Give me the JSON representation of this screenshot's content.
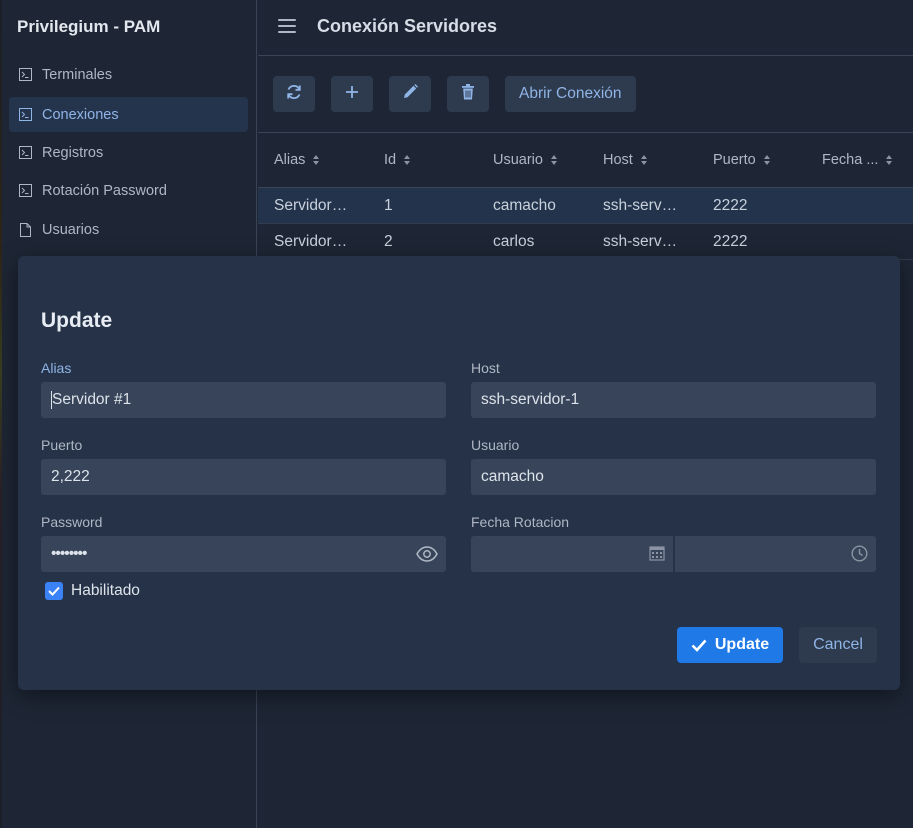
{
  "app": {
    "brand": "Privilegium - PAM"
  },
  "sidebar": {
    "items": [
      {
        "label": "Terminales",
        "icon": "terminal-icon"
      },
      {
        "label": "Conexiones",
        "icon": "terminal-icon",
        "active": true
      },
      {
        "label": "Registros",
        "icon": "terminal-icon"
      },
      {
        "label": "Rotación Password",
        "icon": "terminal-icon"
      },
      {
        "label": "Usuarios",
        "icon": "file-icon"
      }
    ]
  },
  "header": {
    "title": "Conexión Servidores"
  },
  "toolbar": {
    "refresh_icon": "refresh-icon",
    "add_icon": "plus-icon",
    "edit_icon": "pencil-icon",
    "delete_icon": "trash-icon",
    "open_label": "Abrir Conexión"
  },
  "table": {
    "columns": [
      "Alias",
      "Id",
      "Usuario",
      "Host",
      "Puerto",
      "Fecha ..."
    ],
    "rows": [
      [
        "Servidor…",
        "1",
        "camacho",
        "ssh-serv…",
        "2222",
        ""
      ],
      [
        "Servidor…",
        "2",
        "carlos",
        "ssh-serv…",
        "2222",
        ""
      ]
    ]
  },
  "dialog": {
    "title": "Update",
    "alias_label": "Alias",
    "alias_value": "Servidor #1",
    "host_label": "Host",
    "host_value": "ssh-servidor-1",
    "puerto_label": "Puerto",
    "puerto_value": "2,222",
    "usuario_label": "Usuario",
    "usuario_value": "camacho",
    "password_label": "Password",
    "password_value": "••••••••",
    "fecha_label": "Fecha Rotacion",
    "habilitado_label": "Habilitado",
    "habilitado_checked": true,
    "update_label": "Update",
    "cancel_label": "Cancel"
  },
  "colors": {
    "background": "#1e2635",
    "dialog": "#253247",
    "input": "#374459",
    "accent": "#1f7ae8",
    "link": "#8fb4e6"
  }
}
